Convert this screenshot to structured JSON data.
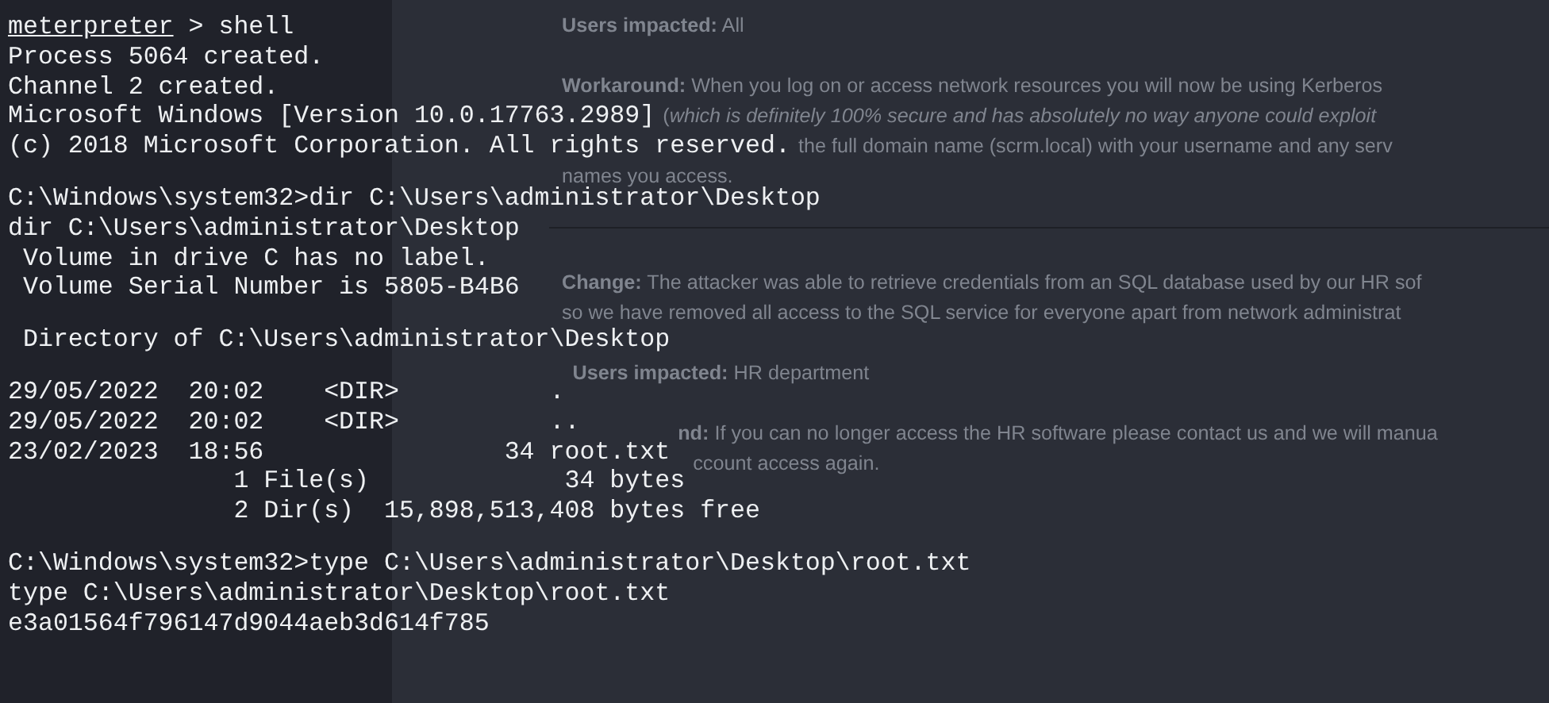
{
  "document": {
    "sections": [
      {
        "paragraphs": [
          {
            "lines": [
              "**Users impacted:** All"
            ]
          },
          {
            "lines": [
              "**Workaround:** When you log on or access network resources you will now be using Kerberos",
              "(*which is definitely 100% secure and has absolutely no way anyone could exploit*",
              "the full domain name (scrm.local) with your username and any serv",
              "names you access."
            ]
          }
        ]
      },
      {
        "paragraphs": [
          {
            "lines": [
              "**Change:** The attacker was able to retrieve credentials from an SQL database used by our HR sof",
              "so we have removed all access to the SQL service for everyone apart from network administrat"
            ]
          },
          {
            "lines": [
              "**Users impacted:** HR department"
            ]
          },
          {
            "lines": [
              "**nd:** If you can no longer access the HR software please contact us and we will manua",
              "ccount access again."
            ]
          }
        ]
      }
    ]
  },
  "terminal": {
    "blocks": [
      [
        {
          "kind": "meterpreter",
          "prompt": "meterpreter",
          "text": " > shell"
        },
        {
          "kind": "output",
          "text": "Process 5064 created."
        },
        {
          "kind": "output",
          "text": "Channel 2 created."
        },
        {
          "kind": "output",
          "text": "Microsoft Windows [Version 10.0.17763.2989]"
        },
        {
          "kind": "output",
          "text": "(c) 2018 Microsoft Corporation. All rights reserved."
        }
      ],
      [
        {
          "kind": "output",
          "text": "C:\\Windows\\system32>dir C:\\Users\\administrator\\Desktop"
        },
        {
          "kind": "output",
          "text": "dir C:\\Users\\administrator\\Desktop"
        },
        {
          "kind": "output",
          "text": " Volume in drive C has no label."
        },
        {
          "kind": "output",
          "text": " Volume Serial Number is 5805-B4B6"
        }
      ],
      [
        {
          "kind": "output",
          "text": " Directory of C:\\Users\\administrator\\Desktop"
        }
      ],
      [
        {
          "kind": "output",
          "text": "29/05/2022  20:02    <DIR>          ."
        },
        {
          "kind": "output",
          "text": "29/05/2022  20:02    <DIR>          .."
        },
        {
          "kind": "output",
          "text": "23/02/2023  18:56                34 root.txt"
        },
        {
          "kind": "output",
          "text": "               1 File(s)             34 bytes"
        },
        {
          "kind": "output",
          "text": "               2 Dir(s)  15,898,513,408 bytes free"
        }
      ],
      [
        {
          "kind": "output",
          "text": "C:\\Windows\\system32>type C:\\Users\\administrator\\Desktop\\root.txt"
        },
        {
          "kind": "output",
          "text": "type C:\\Users\\administrator\\Desktop\\root.txt"
        },
        {
          "kind": "output",
          "text": "e3a01564f796147d9044aeb3d614f785"
        }
      ]
    ]
  }
}
